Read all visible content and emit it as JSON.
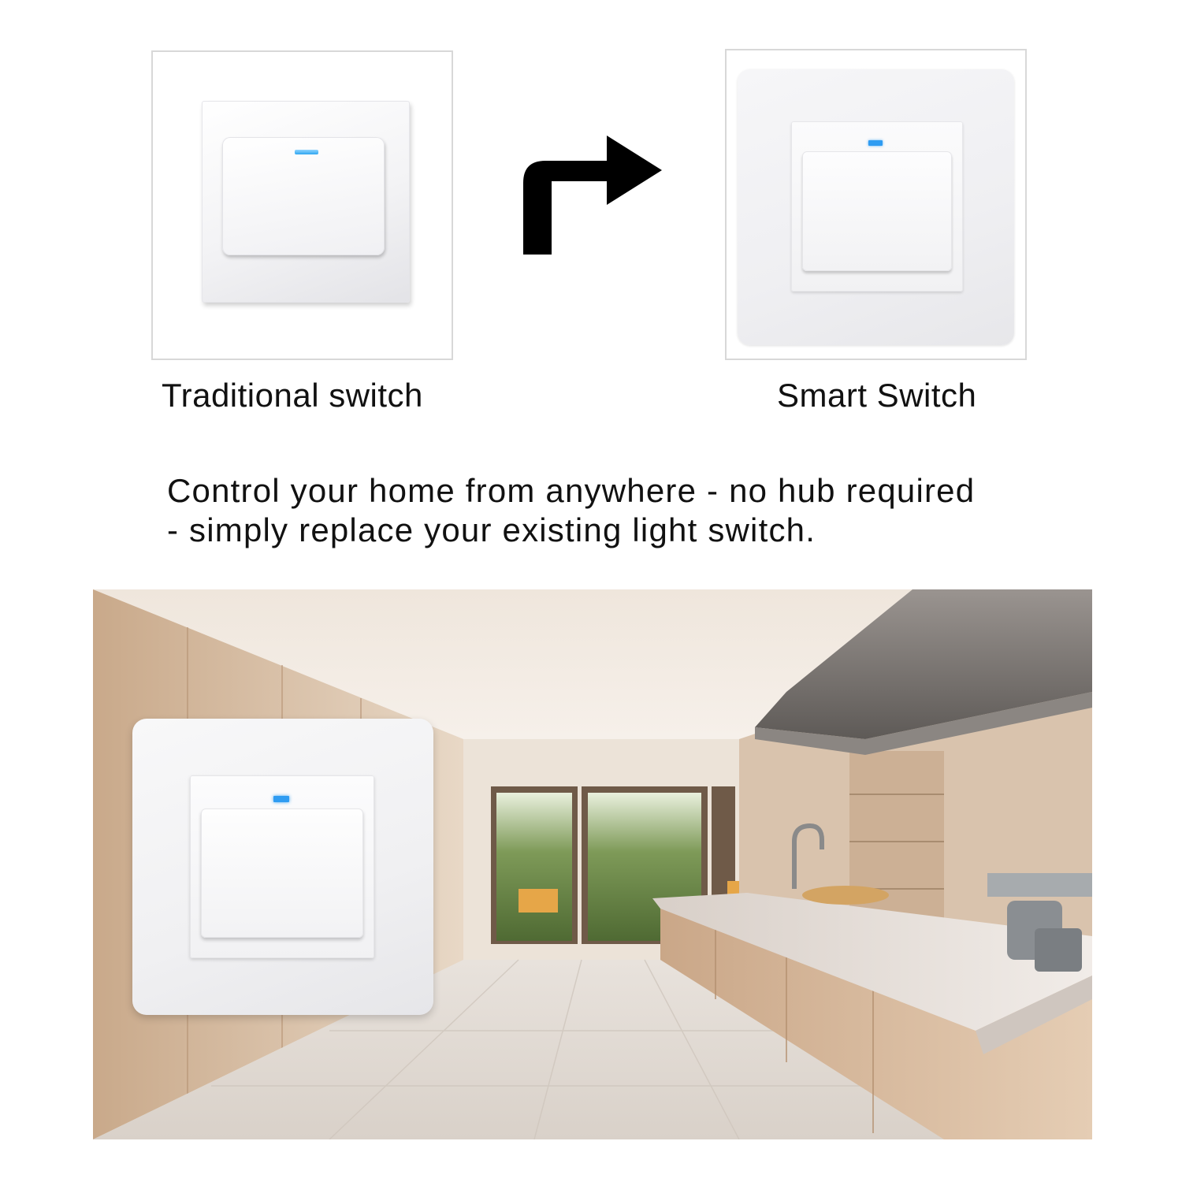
{
  "comparison": {
    "traditional_label": "Traditional switch",
    "smart_label": "Smart Switch"
  },
  "tagline": {
    "line1": "Control your home from anywhere - no hub required",
    "line2": "- simply replace your existing light switch."
  },
  "icons": {
    "arrow": "turn-right-arrow-icon"
  },
  "colors": {
    "led": "#2f9cf2",
    "text": "#111111"
  }
}
